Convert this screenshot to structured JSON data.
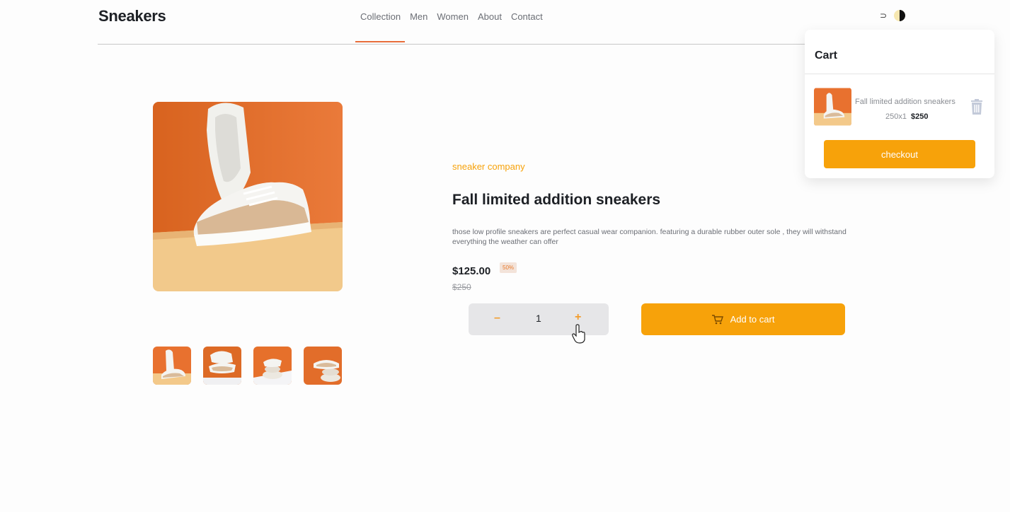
{
  "header": {
    "logo": "Sneakers",
    "nav": [
      "Collection",
      "Men",
      "Women",
      "About",
      "Contact"
    ],
    "cart_icon_glyph": "⊃"
  },
  "cart": {
    "title": "Cart",
    "item": {
      "name": "Fall limited addition sneakers",
      "qty_line": "250x1",
      "total": "$250"
    },
    "checkout_label": "checkout"
  },
  "product": {
    "company": "sneaker company",
    "title": "Fall limited addition sneakers",
    "description": "those low profile sneakers are perfect casual wear companion. featuring a durable rubber outer sole , they will withstand everything the weather can offer",
    "price": "$125.00",
    "discount": "50%",
    "old_price": "$250",
    "quantity": "1",
    "minus_label": "–",
    "plus_label": "+",
    "add_to_cart_label": "Add to cart"
  },
  "colors": {
    "accent": "#f7a20a",
    "orange_bg": "#e8712f",
    "sand": "#f3c98a"
  },
  "icons": [
    "cart-icon",
    "avatar",
    "trash-icon",
    "hand-cursor-icon"
  ]
}
